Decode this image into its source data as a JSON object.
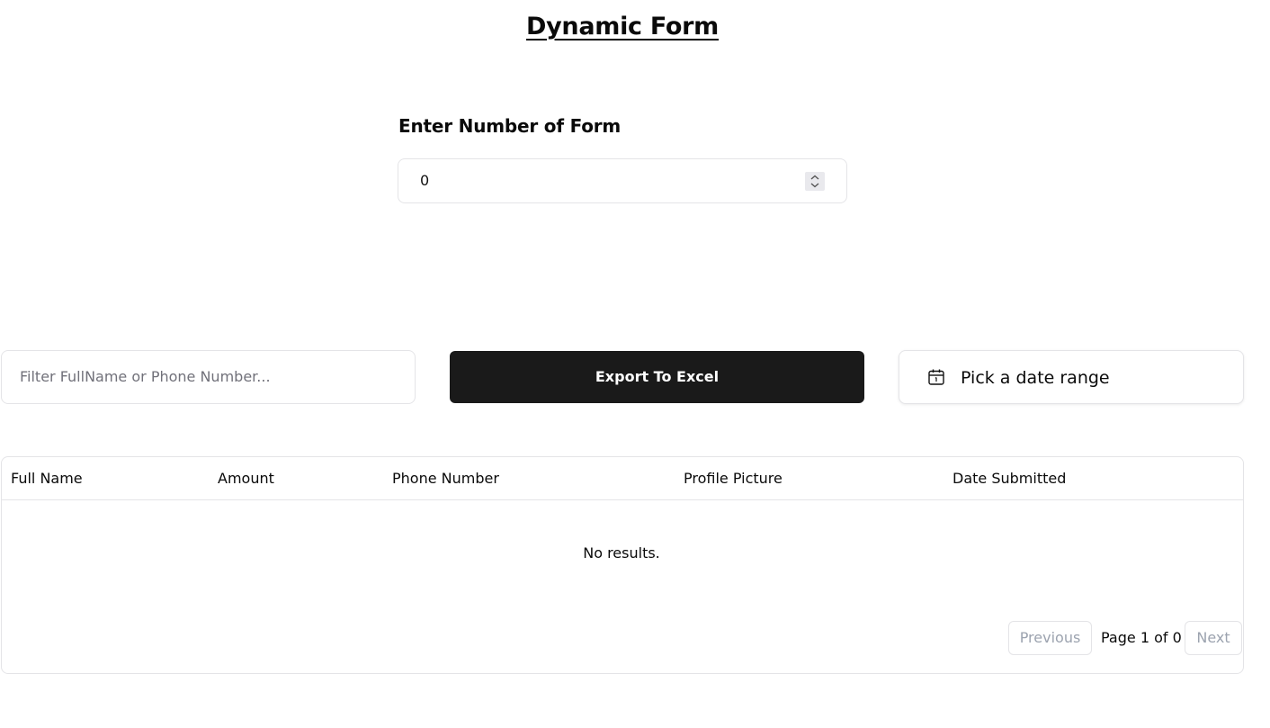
{
  "page": {
    "title": "Dynamic Form"
  },
  "form_count": {
    "label": "Enter Number of Form",
    "value": "0",
    "spinner_icon": "stepper-arrows-icon"
  },
  "toolbar": {
    "filter_placeholder": "Filter FullName or Phone Number...",
    "export_label": "Export To Excel",
    "date_range_label": "Pick a date range",
    "date_icon": "calendar-icon"
  },
  "table": {
    "columns": [
      "Full Name",
      "Amount",
      "Phone Number",
      "Profile Picture",
      "Date Submitted"
    ],
    "empty_text": "No results."
  },
  "pagination": {
    "previous_label": "Previous",
    "page_text": "Page 1 of 0",
    "next_label": "Next"
  },
  "colors": {
    "primary_button": "#1a1a1a",
    "border": "#e4e4e7",
    "muted_text": "#71717a"
  }
}
